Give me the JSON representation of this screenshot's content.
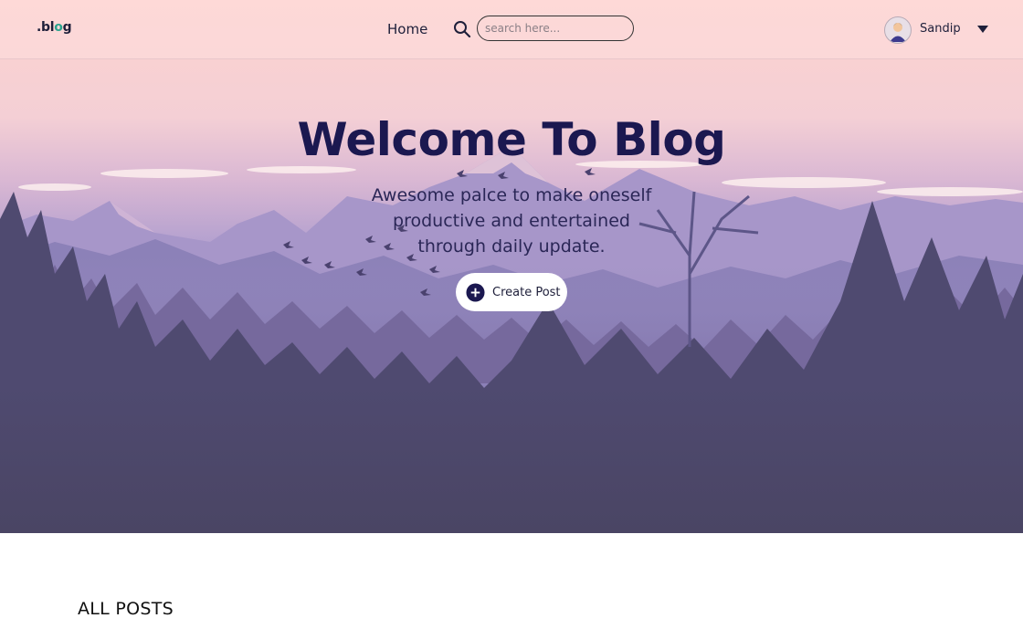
{
  "navbar": {
    "logo_prefix": ".bl",
    "logo_accent": "o",
    "logo_suffix": "g",
    "home_label": "Home",
    "search_placeholder": "search here...",
    "user_name": "Sandip",
    "icons": [
      "search-icon",
      "user-avatar",
      "caret-down-icon"
    ]
  },
  "hero": {
    "title": "Welcome To Blog",
    "subtitle_lines": [
      "Awesome palce to make oneself",
      "productive and entertained",
      "through daily update."
    ],
    "create_button_label": "Create Post",
    "create_button_icon": "plus-circle-icon"
  },
  "section": {
    "title": "ALL POSTS"
  },
  "colors": {
    "sky_top": "#fdd3cf",
    "mountain_far": "#9d8fc4",
    "forest_dark": "#4a4464",
    "title_color": "#1b1850",
    "logo_accent": "#2aa48e"
  }
}
